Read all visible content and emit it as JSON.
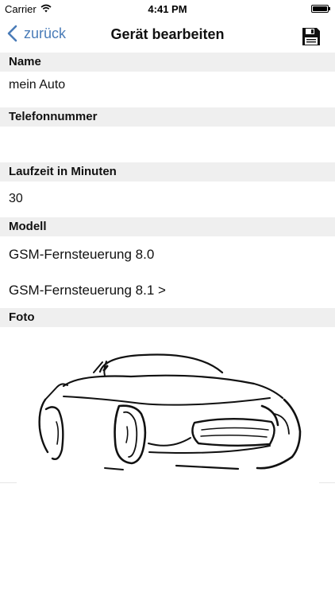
{
  "status_bar": {
    "carrier": "Carrier",
    "time": "4:41 PM",
    "wifi_icon": "wifi-icon",
    "battery_icon": "battery-icon"
  },
  "nav": {
    "back_label": "zurück",
    "title": "Gerät bearbeiten",
    "back_icon": "chevron-left-icon",
    "save_icon": "floppy-disk-save-icon",
    "accent_color": "#4a7cb8"
  },
  "form": {
    "name": {
      "label": "Name",
      "value": "mein Auto"
    },
    "phone": {
      "label": "Telefonnummer",
      "value": ""
    },
    "runtime": {
      "label": "Laufzeit in Minuten",
      "value": "30"
    },
    "model": {
      "label": "Modell",
      "options": [
        {
          "label": "GSM-Fernsteuerung 8.0"
        },
        {
          "label": "GSM-Fernsteuerung 8.1 >"
        }
      ]
    },
    "photo": {
      "label": "Foto",
      "image": "car-sketch-image"
    }
  }
}
